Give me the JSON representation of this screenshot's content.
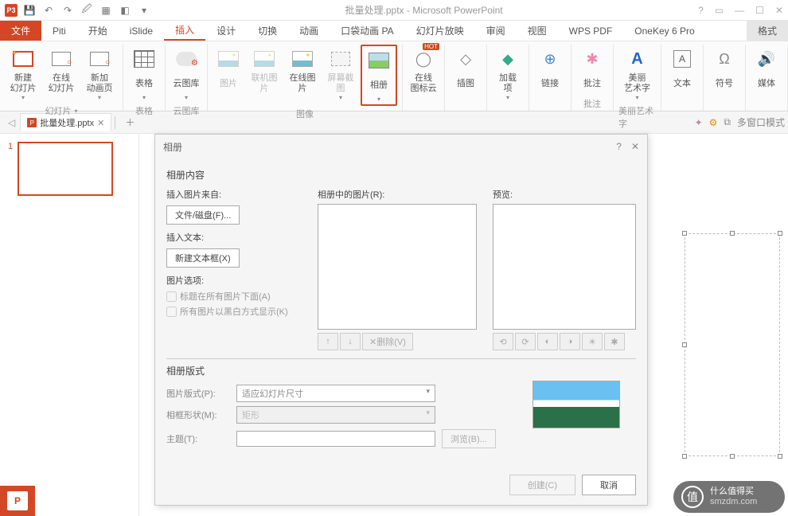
{
  "title": "批量处理.pptx - Microsoft PowerPoint",
  "qat": {
    "pp": "P3"
  },
  "tabs": {
    "file": "文件",
    "items": [
      "Piti",
      "开始",
      "iSlide",
      "插入",
      "设计",
      "切换",
      "动画",
      "口袋动画 PA",
      "幻灯片放映",
      "审阅",
      "视图",
      "WPS PDF",
      "OneKey 6 Pro"
    ],
    "active_index": 3,
    "format": "格式"
  },
  "ribbon": {
    "groups": [
      {
        "label": "幻灯片",
        "items": [
          {
            "name": "new-slide",
            "label": "新建\n幻灯片",
            "dd": true
          },
          {
            "name": "online-slide",
            "label": "在线\n幻灯片"
          },
          {
            "name": "new-anim",
            "label": "新加\n动画页"
          }
        ]
      },
      {
        "label": "表格",
        "items": [
          {
            "name": "table",
            "label": "表格",
            "dd": true
          }
        ]
      },
      {
        "label": "云图库",
        "items": [
          {
            "name": "cloud-lib",
            "label": "云图库",
            "dd": true
          }
        ]
      },
      {
        "label": "图像",
        "items": [
          {
            "name": "picture",
            "label": "图片"
          },
          {
            "name": "online-pic",
            "label": "联机图片"
          },
          {
            "name": "online-pic2",
            "label": "在线图片"
          },
          {
            "name": "screenshot",
            "label": "屏幕截图",
            "dd": true
          },
          {
            "name": "album",
            "label": "相册",
            "dd": true,
            "highlight": true
          }
        ]
      },
      {
        "label": "",
        "items": [
          {
            "name": "online-iconcloud",
            "label": "在线\n图标云",
            "new": true
          }
        ]
      },
      {
        "label": "",
        "items": [
          {
            "name": "illustration",
            "label": "插图"
          }
        ]
      },
      {
        "label": "",
        "items": [
          {
            "name": "addins",
            "label": "加载\n项",
            "dd": true
          }
        ]
      },
      {
        "label": "",
        "items": [
          {
            "name": "links",
            "label": "链接"
          }
        ]
      },
      {
        "label": "批注",
        "items": [
          {
            "name": "comment",
            "label": "批注"
          }
        ]
      },
      {
        "label": "美丽艺术字",
        "items": [
          {
            "name": "wordart",
            "label": "美丽\n艺术字",
            "dd": true
          }
        ]
      },
      {
        "label": "",
        "items": [
          {
            "name": "text",
            "label": "文本"
          }
        ]
      },
      {
        "label": "",
        "items": [
          {
            "name": "symbol",
            "label": "符号"
          }
        ]
      },
      {
        "label": "",
        "items": [
          {
            "name": "media",
            "label": "媒体"
          }
        ]
      }
    ]
  },
  "doctab": {
    "name": "批量处理.pptx",
    "multiwin": "多窗口模式"
  },
  "thumbs": {
    "num": "1"
  },
  "dialog": {
    "title": "相册",
    "section_content": "相册内容",
    "insert_from": "插入图片来自:",
    "file_disk": "文件/磁盘(F)...",
    "insert_text": "插入文本:",
    "new_textbox": "新建文本框(X)",
    "pic_options": "图片选项:",
    "caption_below": "标题在所有图片下面(A)",
    "all_bw": "所有图片以黑白方式显示(K)",
    "pics_in_album": "相册中的图片(R):",
    "preview": "预览:",
    "remove": "删除(V)",
    "section_layout": "相册版式",
    "pic_layout": "图片版式(P):",
    "pic_layout_val": "适应幻灯片尺寸",
    "frame_shape": "相框形状(M):",
    "frame_shape_val": "矩形",
    "theme": "主题(T):",
    "browse": "浏览(B)...",
    "create": "创建(C)",
    "cancel": "取消"
  },
  "watermark": {
    "ch": "值",
    "line1": "什么值得买",
    "line2": "smzdm.com"
  },
  "status": {
    "pp": "P"
  }
}
